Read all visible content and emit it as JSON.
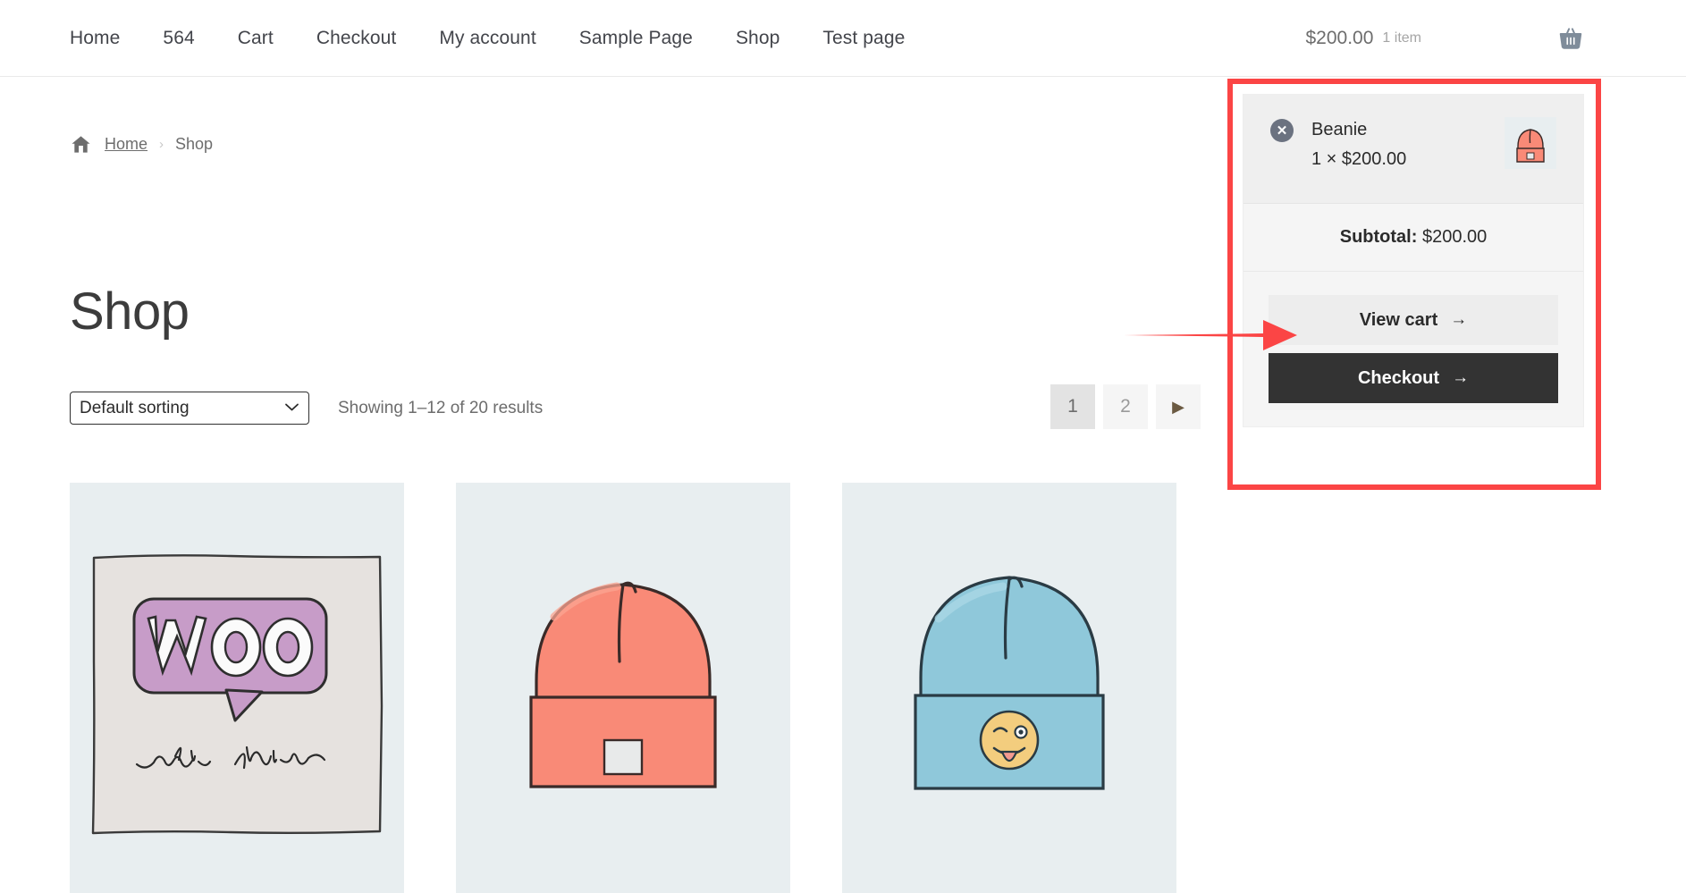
{
  "nav": {
    "items": [
      {
        "label": "Home"
      },
      {
        "label": "564"
      },
      {
        "label": "Cart"
      },
      {
        "label": "Checkout"
      },
      {
        "label": "My account"
      },
      {
        "label": "Sample Page"
      },
      {
        "label": "Shop"
      },
      {
        "label": "Test page"
      }
    ],
    "cart": {
      "amount": "$200.00",
      "count": "1 item",
      "icon": "shopping-basket-icon"
    }
  },
  "breadcrumb": {
    "home_icon": "home-icon",
    "home_label": "Home",
    "separator": "›",
    "current": "Shop"
  },
  "page": {
    "title": "Shop"
  },
  "toolbar": {
    "sorting_value": "Default sorting",
    "sorting_options": [
      "Default sorting"
    ],
    "chevron": "⌄",
    "result_count": "Showing 1–12 of 20 results"
  },
  "pagination": {
    "pages": [
      "1",
      "2"
    ],
    "active": "1",
    "next_icon": "▶"
  },
  "products": [
    {
      "name": "woo-album-cover",
      "caption_top": "Woo",
      "caption_bottom_1": "the",
      "caption_bottom_2": "album"
    },
    {
      "name": "beanie-salmon"
    },
    {
      "name": "beanie-blue"
    }
  ],
  "mini_cart": {
    "item": {
      "remove_icon": "✕",
      "name": "Beanie",
      "quantity_price": "1 × $200.00",
      "thumbnail": "beanie-salmon-thumbnail"
    },
    "subtotal_label": "Subtotal:",
    "subtotal_value": "$200.00",
    "view_cart_label": "View cart",
    "checkout_label": "Checkout",
    "arrow": "→"
  },
  "annotations": {
    "highlight_color": "#fb4545",
    "arrow_target": "view-cart-button"
  }
}
